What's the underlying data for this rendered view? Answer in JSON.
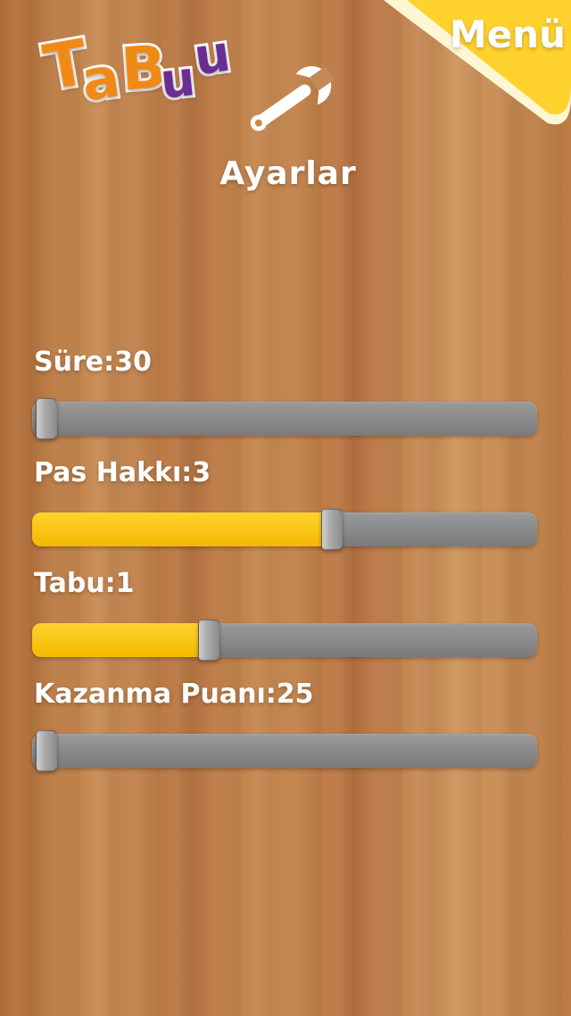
{
  "logo": {
    "text": "TaBuu",
    "letters": [
      "T",
      "a",
      "B",
      "u",
      "u"
    ]
  },
  "header": {
    "title": "Ayarlar",
    "menu_label": "Menü"
  },
  "icons": {
    "settings": "wrench-icon"
  },
  "colors": {
    "menu_yellow": "#ffd22e",
    "slider_fill": "#ffc400",
    "slider_track": "#8f8f8f",
    "logo_orange": "#f08a17",
    "logo_purple": "#6a2e93"
  },
  "settings": {
    "sure": {
      "label": "Süre:30",
      "fraction": 0.0
    },
    "pas_hakki": {
      "label": "Pas Hakkı:3",
      "fraction": 0.6
    },
    "tabu": {
      "label": "Tabu:1",
      "fraction": 0.34
    },
    "kazanma_puani": {
      "label": "Kazanma Puanı:25",
      "fraction": 0.0
    }
  }
}
